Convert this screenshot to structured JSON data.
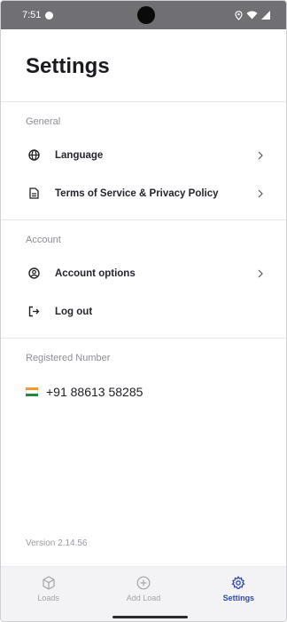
{
  "status_bar": {
    "time": "7:51"
  },
  "header": {
    "title": "Settings"
  },
  "sections": {
    "general": {
      "title": "General",
      "items": [
        {
          "label": "Language",
          "icon": "globe-icon"
        },
        {
          "label": "Terms of Service & Privacy Policy",
          "icon": "document-icon"
        }
      ]
    },
    "account": {
      "title": "Account",
      "items": [
        {
          "label": "Account options",
          "icon": "user-circle-icon"
        },
        {
          "label": "Log out",
          "icon": "logout-icon"
        }
      ]
    },
    "registered": {
      "title": "Registered Number",
      "phone": "+91 88613 58285"
    }
  },
  "version": "Version 2.14.56",
  "bottom_nav": {
    "items": [
      {
        "label": "Loads",
        "icon": "cube-icon"
      },
      {
        "label": "Add Load",
        "icon": "plus-circle-icon"
      },
      {
        "label": "Settings",
        "icon": "gear-icon"
      }
    ],
    "active": "Settings"
  },
  "colors": {
    "accent": "#2f4aa8",
    "status_bar": "#6f6f74",
    "muted_text": "#8d8d93",
    "nav_background": "#f3f3f6"
  }
}
